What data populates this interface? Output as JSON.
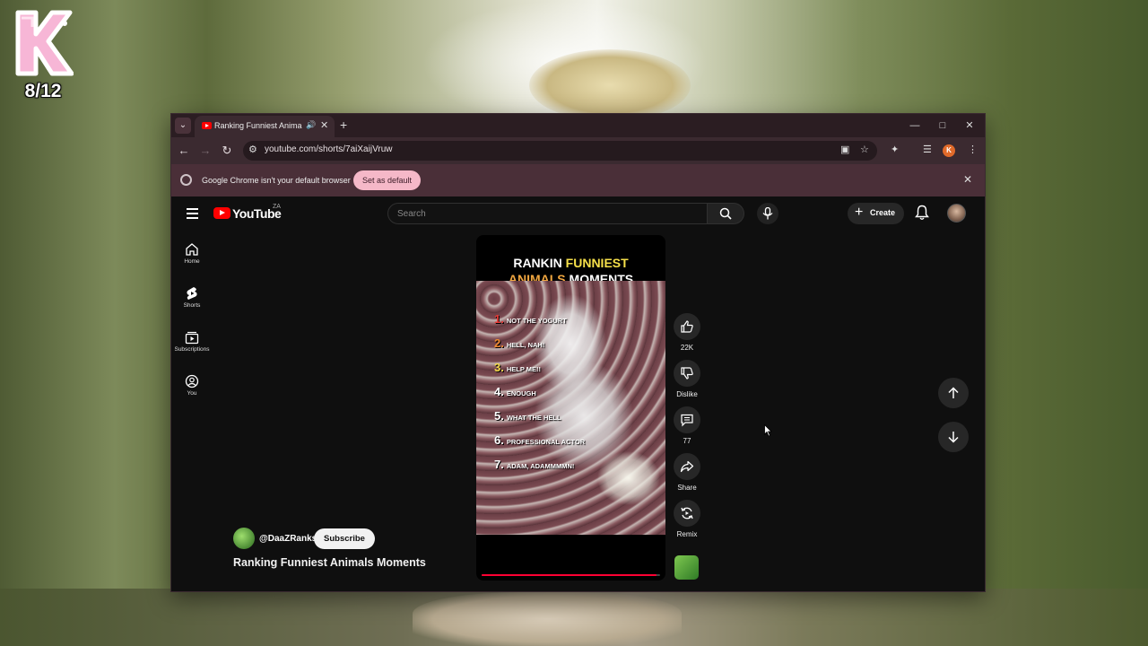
{
  "overlay": {
    "badge_letter": "K",
    "badge_count": "8/12"
  },
  "browser": {
    "tab": {
      "title": "Ranking Funniest Animals M",
      "audio_icon": "speaker-icon",
      "close_icon": "close-icon"
    },
    "new_tab_icon": "plus-icon",
    "url": "youtube.com/shorts/7aiXaijVruw",
    "profile_initial": "K",
    "infobar": {
      "message": "Google Chrome isn't your default browser",
      "button_label": "Set as default"
    },
    "colors": {
      "tabstrip": "#2b1d22",
      "toolbar": "#3b2a30",
      "infobar": "#4a2f38",
      "set_default_button": "#f5b8c8"
    }
  },
  "youtube": {
    "logo_text": "YouTube",
    "country_code": "ZA",
    "search_placeholder": "Search",
    "create_label": "Create",
    "sidebar": [
      {
        "label": "Home",
        "icon": "home-icon"
      },
      {
        "label": "Shorts",
        "icon": "shorts-icon"
      },
      {
        "label": "Subscriptions",
        "icon": "subscriptions-icon"
      },
      {
        "label": "You",
        "icon": "you-icon"
      }
    ],
    "short": {
      "title_line1_a": "RANKIN ",
      "title_line1_b": "FUNNIEST",
      "title_line2_a": "ANIMALS",
      "title_line2_b": " MOMENTS",
      "rankings": [
        {
          "num": "1.",
          "text": "NOT THE YOGURT",
          "color": "#e53935"
        },
        {
          "num": "2.",
          "text": "HELL, NAH!",
          "color": "#f08a30"
        },
        {
          "num": "3.",
          "text": "HELP ME!!",
          "color": "#f6d94a"
        },
        {
          "num": "4.",
          "text": "ENOUGH",
          "color": "#ffffff"
        },
        {
          "num": "5.",
          "text": "WHAT THE HELL",
          "color": "#ffffff"
        },
        {
          "num": "6.",
          "text": "PROFESSIONAL ACTOR",
          "color": "#ffffff"
        },
        {
          "num": "7.",
          "text": "ADAM, ADAMMMMN!",
          "color": "#ffffff"
        }
      ],
      "progress_fraction": 0.98
    },
    "actions": {
      "like_count": "22K",
      "dislike_label": "Dislike",
      "comment_count": "77",
      "share_label": "Share",
      "remix_label": "Remix"
    },
    "channel_handle": "@DaaZRanks",
    "subscribe_label": "Subscribe",
    "video_title": "Ranking Funniest Animals Moments"
  }
}
